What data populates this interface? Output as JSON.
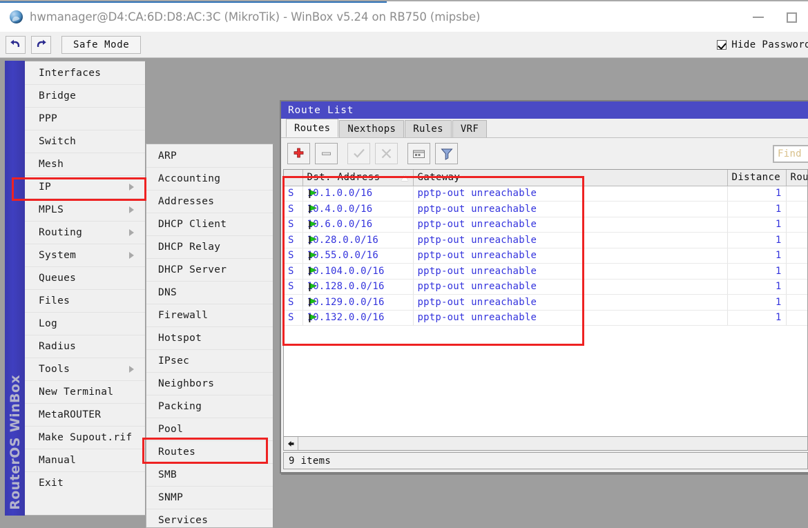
{
  "window": {
    "title": "hwmanager@D4:CA:6D:D8:AC:3C (MikroTik) - WinBox v5.24 on RB750 (mipsbe)",
    "logo_icon": "winbox-globe-icon",
    "minimize_icon": "minimize-icon",
    "maximize_icon": "maximize-icon"
  },
  "toolbar": {
    "undo_icon": "undo-arrow-icon",
    "redo_icon": "redo-arrow-icon",
    "safe_mode_label": "Safe Mode",
    "hide_password_label": "Hide Password",
    "hide_password_checked": true
  },
  "sidebar": {
    "brand": "RouterOS WinBox",
    "items": [
      {
        "label": "Interfaces",
        "has_submenu": false
      },
      {
        "label": "Bridge",
        "has_submenu": false
      },
      {
        "label": "PPP",
        "has_submenu": false
      },
      {
        "label": "Switch",
        "has_submenu": false
      },
      {
        "label": "Mesh",
        "has_submenu": false
      },
      {
        "label": "IP",
        "has_submenu": true,
        "highlighted": true
      },
      {
        "label": "MPLS",
        "has_submenu": true
      },
      {
        "label": "Routing",
        "has_submenu": true
      },
      {
        "label": "System",
        "has_submenu": true
      },
      {
        "label": "Queues",
        "has_submenu": false
      },
      {
        "label": "Files",
        "has_submenu": false
      },
      {
        "label": "Log",
        "has_submenu": false
      },
      {
        "label": "Radius",
        "has_submenu": false
      },
      {
        "label": "Tools",
        "has_submenu": true
      },
      {
        "label": "New Terminal",
        "has_submenu": false
      },
      {
        "label": "MetaROUTER",
        "has_submenu": false
      },
      {
        "label": "Make Supout.rif",
        "has_submenu": false
      },
      {
        "label": "Manual",
        "has_submenu": false
      },
      {
        "label": "Exit",
        "has_submenu": false
      }
    ]
  },
  "submenu": {
    "parent": "IP",
    "items": [
      {
        "label": "ARP"
      },
      {
        "label": "Accounting"
      },
      {
        "label": "Addresses"
      },
      {
        "label": "DHCP Client"
      },
      {
        "label": "DHCP Relay"
      },
      {
        "label": "DHCP Server"
      },
      {
        "label": "DNS"
      },
      {
        "label": "Firewall"
      },
      {
        "label": "Hotspot"
      },
      {
        "label": "IPsec"
      },
      {
        "label": "Neighbors"
      },
      {
        "label": "Packing"
      },
      {
        "label": "Pool"
      },
      {
        "label": "Routes",
        "highlighted": true
      },
      {
        "label": "SMB"
      },
      {
        "label": "SNMP"
      },
      {
        "label": "Services"
      }
    ]
  },
  "route_list": {
    "title": "Route List",
    "tabs": [
      {
        "label": "Routes",
        "active": true
      },
      {
        "label": "Nexthops",
        "active": false
      },
      {
        "label": "Rules",
        "active": false
      },
      {
        "label": "VRF",
        "active": false
      }
    ],
    "toolbar_buttons": [
      {
        "name": "add-button",
        "icon": "plus-icon",
        "enabled": true
      },
      {
        "name": "remove-button",
        "icon": "minus-icon",
        "enabled": true
      },
      {
        "name": "enable-button",
        "icon": "check-icon",
        "enabled": false
      },
      {
        "name": "disable-button",
        "icon": "cross-icon",
        "enabled": false
      },
      {
        "name": "comment-button",
        "icon": "comment-icon",
        "enabled": true
      },
      {
        "name": "filter-button",
        "icon": "funnel-icon",
        "enabled": true
      }
    ],
    "find_placeholder": "Find",
    "columns": [
      "",
      "Dst. Address",
      "Gateway",
      "Distance",
      "Rou"
    ],
    "sort_column": "Dst. Address",
    "rows": [
      {
        "flag": "S",
        "dst": "10.1.0.0/16",
        "gateway": "pptp-out unreachable",
        "distance": "1",
        "routing_mark": ""
      },
      {
        "flag": "S",
        "dst": "10.4.0.0/16",
        "gateway": "pptp-out unreachable",
        "distance": "1",
        "routing_mark": ""
      },
      {
        "flag": "S",
        "dst": "10.6.0.0/16",
        "gateway": "pptp-out unreachable",
        "distance": "1",
        "routing_mark": ""
      },
      {
        "flag": "S",
        "dst": "10.28.0.0/16",
        "gateway": "pptp-out unreachable",
        "distance": "1",
        "routing_mark": ""
      },
      {
        "flag": "S",
        "dst": "10.55.0.0/16",
        "gateway": "pptp-out unreachable",
        "distance": "1",
        "routing_mark": ""
      },
      {
        "flag": "S",
        "dst": "10.104.0.0/16",
        "gateway": "pptp-out unreachable",
        "distance": "1",
        "routing_mark": ""
      },
      {
        "flag": "S",
        "dst": "10.128.0.0/16",
        "gateway": "pptp-out unreachable",
        "distance": "1",
        "routing_mark": ""
      },
      {
        "flag": "S",
        "dst": "10.129.0.0/16",
        "gateway": "pptp-out unreachable",
        "distance": "1",
        "routing_mark": ""
      },
      {
        "flag": "S",
        "dst": "10.132.0.0/16",
        "gateway": "pptp-out unreachable",
        "distance": "1",
        "routing_mark": ""
      }
    ],
    "status_text": "9 items",
    "scroll_left_icon": "scroll-left-icon"
  },
  "colors": {
    "accent_blue": "#4a4ac4",
    "highlight_red": "#ee2222",
    "row_text_blue": "#3333dd",
    "flag_green": "#19c219"
  }
}
